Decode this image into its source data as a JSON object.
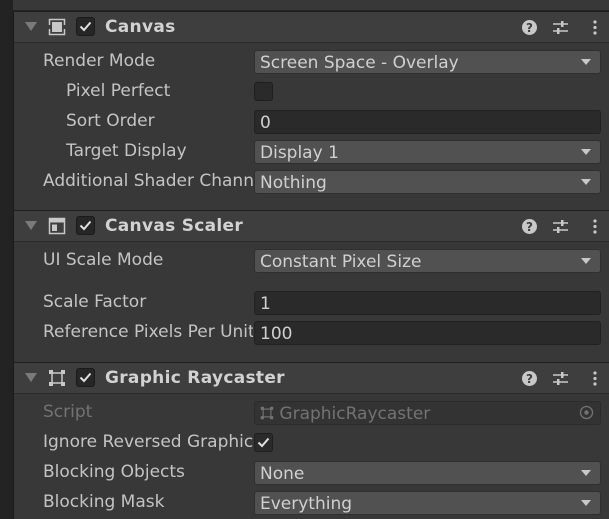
{
  "colors": {
    "background": "#383838",
    "header": "#3e3e3e",
    "dropdown": "#515151",
    "textfield": "#2a2a2a",
    "text": "#c4c4c4",
    "disabled_text": "#737373"
  },
  "canvas": {
    "title": "Canvas",
    "icon": "canvas-icon",
    "enabled": true,
    "render_mode": {
      "label": "Render Mode",
      "value": "Screen Space - Overlay"
    },
    "pixel_perfect": {
      "label": "Pixel Perfect",
      "checked": false
    },
    "sort_order": {
      "label": "Sort Order",
      "value": "0"
    },
    "target_display": {
      "label": "Target Display",
      "value": "Display 1"
    },
    "additional_shader_channels": {
      "label": "Additional Shader Channels",
      "value": "Nothing"
    }
  },
  "canvas_scaler": {
    "title": "Canvas Scaler",
    "icon": "canvas-scaler-icon",
    "enabled": true,
    "ui_scale_mode": {
      "label": "UI Scale Mode",
      "value": "Constant Pixel Size"
    },
    "scale_factor": {
      "label": "Scale Factor",
      "value": "1"
    },
    "reference_pixels_per_unit": {
      "label": "Reference Pixels Per Unit",
      "value": "100"
    }
  },
  "graphic_raycaster": {
    "title": "Graphic Raycaster",
    "icon": "rect-transform-icon",
    "enabled": true,
    "script": {
      "label": "Script",
      "value": "GraphicRaycaster"
    },
    "ignore_reversed_graphics": {
      "label": "Ignore Reversed Graphics",
      "checked": true
    },
    "blocking_objects": {
      "label": "Blocking Objects",
      "value": "None"
    },
    "blocking_mask": {
      "label": "Blocking Mask",
      "value": "Everything"
    }
  }
}
